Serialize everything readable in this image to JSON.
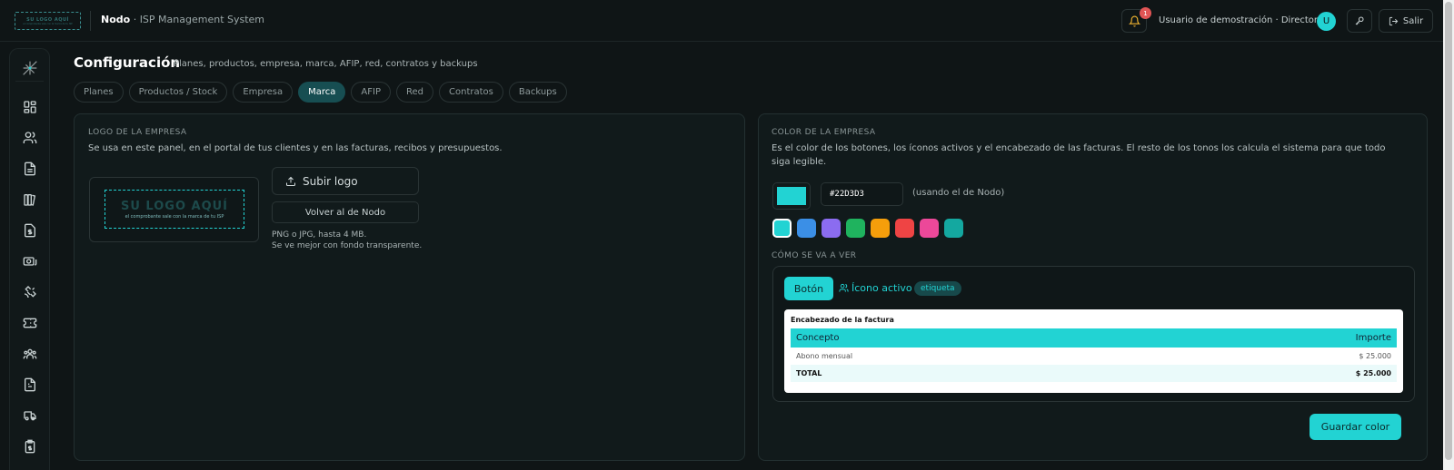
{
  "header": {
    "logo_text": "SU LOGO AQUÍ",
    "logo_subtext": "el comprobante sale con la marca de tu ISP",
    "brand_name": "Nodo",
    "brand_suffix": " · ISP Management System",
    "notifications_count": "1",
    "user_name": "Usuario de demostración · Director",
    "avatar_initial": "U",
    "exit_label": "Salir"
  },
  "sidebar": {
    "items": [
      "dashboard-icon",
      "users-icon",
      "document-icon",
      "books-icon",
      "invoice-icon",
      "camera-money-icon",
      "satellite-icon",
      "ticket-icon",
      "team-icon",
      "report-icon",
      "truck-icon",
      "clipboard-icon"
    ]
  },
  "page": {
    "title": "Configuración",
    "subtitle": "Planes, productos, empresa, marca, AFIP, red, contratos y backups"
  },
  "tabs": [
    {
      "label": "Planes",
      "active": false
    },
    {
      "label": "Productos / Stock",
      "active": false
    },
    {
      "label": "Empresa",
      "active": false
    },
    {
      "label": "Marca",
      "active": true
    },
    {
      "label": "AFIP",
      "active": false
    },
    {
      "label": "Red",
      "active": false
    },
    {
      "label": "Contratos",
      "active": false
    },
    {
      "label": "Backups",
      "active": false
    }
  ],
  "logo_panel": {
    "label": "LOGO DE LA EMPRESA",
    "description": "Se usa en este panel, en el portal de tus clientes y en las facturas, recibos y presupuestos.",
    "placeholder_big": "SU LOGO AQUÍ",
    "placeholder_small": "el comprobante sale con la marca de tu ISP",
    "upload_label": "Subir logo",
    "revert_label": "Volver al de Nodo",
    "hint_1": "PNG o JPG, hasta 4 MB.",
    "hint_2": "Se ve mejor con fondo transparente."
  },
  "color_panel": {
    "label": "COLOR DE LA EMPRESA",
    "description": "Es el color de los botones, los íconos activos y el encabezado de las facturas. El resto de los tonos los calcula el sistema para que todo siga legible.",
    "hex_value": "#22D3D3",
    "using_note": "(usando el de Nodo)",
    "presets": [
      "#22d3d3",
      "#3b8fe6",
      "#8b6cf0",
      "#1fb35e",
      "#f59e0b",
      "#ef4444",
      "#ec4899",
      "#14a8a0"
    ],
    "preview_label": "CÓMO SE VA A VER",
    "preview_button": "Botón",
    "preview_icon_label": "Ícono activo",
    "preview_tag": "etiqueta",
    "invoice_title": "Encabezado de la factura",
    "invoice_col_concept": "Concepto",
    "invoice_col_amount": "Importe",
    "invoice_row_concept": "Abono mensual",
    "invoice_row_amount": "$ 25.000",
    "invoice_total_label": "TOTAL",
    "invoice_total_amount": "$ 25.000",
    "save_label": "Guardar color"
  },
  "colors": {
    "accent": "#22d3d3",
    "background": "#0f1516",
    "panel": "#111a1b"
  }
}
